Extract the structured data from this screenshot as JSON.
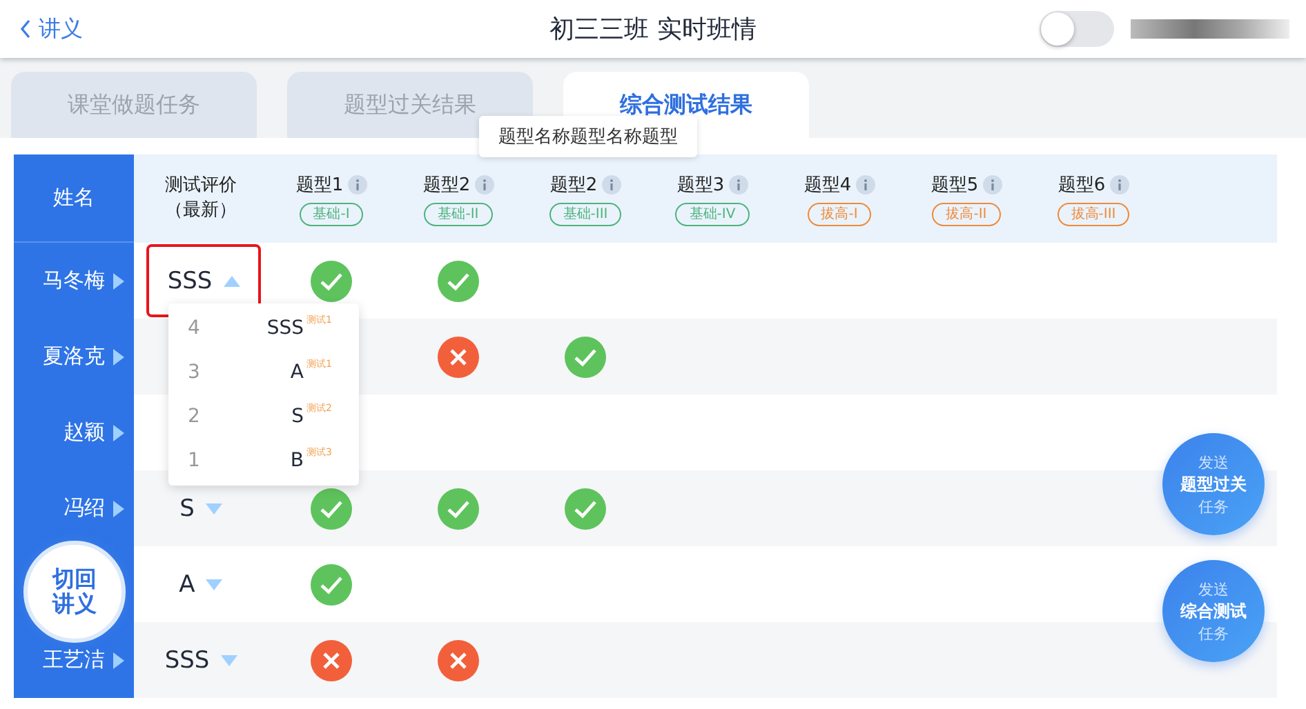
{
  "header": {
    "back": "讲义",
    "title": "初三三班 实时班情",
    "toggle": {
      "on": false
    }
  },
  "tabs": [
    {
      "label": "课堂做题任务",
      "selected": false
    },
    {
      "label": "题型过关结果",
      "selected": false
    },
    {
      "label": "综合测试结果",
      "selected": true
    }
  ],
  "tooltip": "题型名称题型名称题型",
  "table": {
    "name_heading": "姓名",
    "rating_heading": [
      "测试评价",
      "（最新）"
    ],
    "columns": [
      {
        "label": "题型1",
        "tag": "基础-I",
        "color": "#4fb37e"
      },
      {
        "label": "题型2",
        "tag": "基础-II",
        "color": "#4fb37e"
      },
      {
        "label": "题型2",
        "tag": "基础-III",
        "color": "#4fb37e"
      },
      {
        "label": "题型3",
        "tag": "基础-IV",
        "color": "#4fb37e"
      },
      {
        "label": "题型4",
        "tag": "拔高-I",
        "color": "#ee8a3a"
      },
      {
        "label": "题型5",
        "tag": "拔高-II",
        "color": "#ee8a3a"
      },
      {
        "label": "题型6",
        "tag": "拔高-III",
        "color": "#ee8a3a"
      }
    ],
    "rows": [
      {
        "name": "马冬梅",
        "rating": "SSS",
        "open": true,
        "results": [
          {
            "kind": "pass"
          },
          {
            "kind": "pass"
          },
          {
            "kind": "empty"
          },
          {
            "kind": "empty"
          },
          {
            "kind": "empty"
          },
          {
            "kind": "empty"
          },
          {
            "kind": "empty"
          }
        ]
      },
      {
        "name": "夏洛克",
        "open": false,
        "results": [
          {
            "kind": "empty"
          },
          {
            "kind": "fail"
          },
          {
            "kind": "pass"
          },
          {
            "kind": "empty"
          },
          {
            "kind": "empty"
          },
          {
            "kind": "empty"
          },
          {
            "kind": "empty"
          }
        ]
      },
      {
        "name": "赵颖",
        "open": false,
        "results": [
          {
            "kind": "empty"
          },
          {
            "kind": "empty"
          },
          {
            "kind": "empty"
          },
          {
            "kind": "empty"
          },
          {
            "kind": "empty"
          },
          {
            "kind": "empty"
          },
          {
            "kind": "empty"
          }
        ]
      },
      {
        "name": "冯绍",
        "rating": "S",
        "open": false,
        "results": [
          {
            "kind": "pass"
          },
          {
            "kind": "pass"
          },
          {
            "kind": "pass"
          },
          {
            "kind": "empty"
          },
          {
            "kind": "empty"
          },
          {
            "kind": "empty"
          },
          {
            "kind": "empty"
          }
        ]
      },
      {
        "rating": "A",
        "open": false,
        "results": [
          {
            "kind": "pass"
          },
          {
            "kind": "empty"
          },
          {
            "kind": "empty"
          },
          {
            "kind": "empty"
          },
          {
            "kind": "empty"
          },
          {
            "kind": "empty"
          },
          {
            "kind": "empty"
          }
        ]
      },
      {
        "name": "王艺洁",
        "rating": "SSS",
        "open": false,
        "results": [
          {
            "kind": "fail"
          },
          {
            "kind": "fail"
          },
          {
            "kind": "empty"
          },
          {
            "kind": "empty"
          },
          {
            "kind": "empty"
          },
          {
            "kind": "empty"
          },
          {
            "kind": "empty"
          }
        ]
      }
    ]
  },
  "dropdown": [
    {
      "number": "4",
      "grade": "SSS",
      "test": "测试1"
    },
    {
      "number": "3",
      "grade": "A",
      "test": "测试1"
    },
    {
      "number": "2",
      "grade": "S",
      "test": "测试2"
    },
    {
      "number": "1",
      "grade": "B",
      "test": "测试3"
    }
  ],
  "back_button": [
    "切回",
    "讲义"
  ],
  "send_buttons": [
    {
      "top": "发送",
      "main": "题型过关",
      "bottom": "任务"
    },
    {
      "top": "发送",
      "main": "综合测试",
      "bottom": "任务"
    }
  ]
}
